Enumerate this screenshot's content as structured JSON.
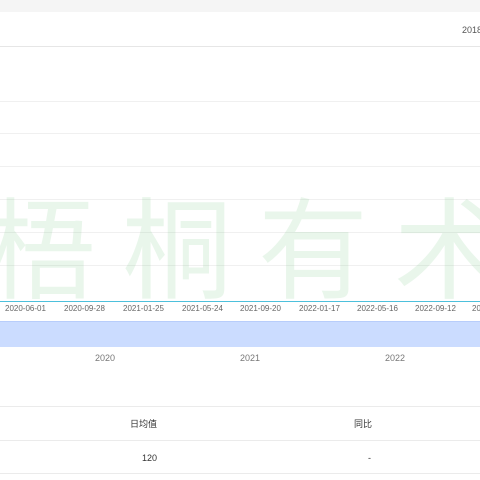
{
  "header": {
    "range_label": "2018"
  },
  "watermark": {
    "text": "梧桐有术"
  },
  "timeline": {
    "ticks": [
      "2020-06-01",
      "2020-09-28",
      "2021-01-25",
      "2021-05-24",
      "2021-09-20",
      "2022-01-17",
      "2022-05-16",
      "2022-09-12",
      "20"
    ],
    "years": [
      "2020",
      "2021",
      "2022"
    ]
  },
  "table": {
    "headers": {
      "avg": "日均值",
      "yoy": "同比"
    },
    "rows": [
      {
        "avg": "120",
        "yoy": "-"
      }
    ]
  }
}
